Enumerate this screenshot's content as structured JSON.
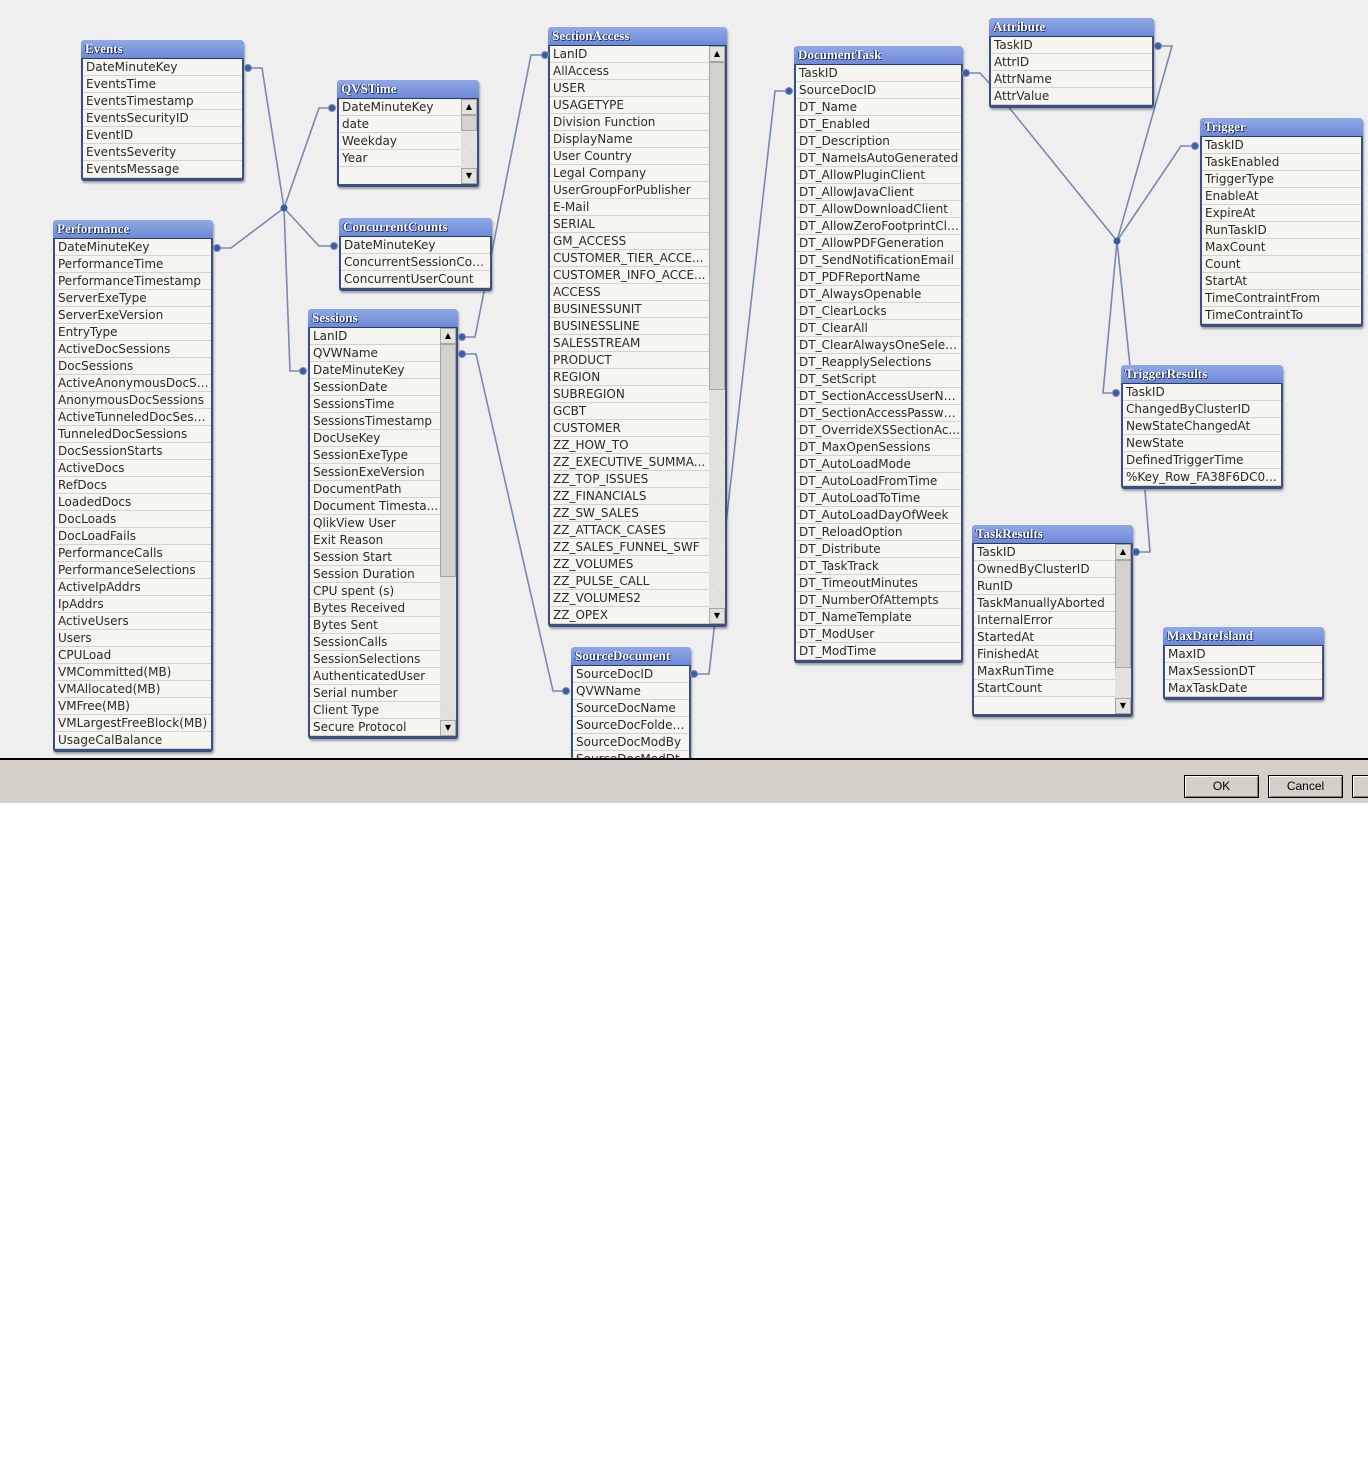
{
  "tables": {
    "events": {
      "title": "Events",
      "fields": [
        "DateMinuteKey",
        "EventsTime",
        "EventsTimestamp",
        "EventsSecurityID",
        "EventID",
        "EventsSeverity",
        "EventsMessage"
      ]
    },
    "qvstime": {
      "title": "QVSTime",
      "fields": [
        "DateMinuteKey",
        "date",
        "Weekday",
        "Year"
      ]
    },
    "concurrentcounts": {
      "title": "ConcurrentCounts",
      "fields": [
        "DateMinuteKey",
        "ConcurrentSessionCount",
        "ConcurrentUserCount"
      ]
    },
    "performance": {
      "title": "Performance",
      "fields": [
        "DateMinuteKey",
        "PerformanceTime",
        "PerformanceTimestamp",
        "ServerExeType",
        "ServerExeVersion",
        "EntryType",
        "ActiveDocSessions",
        "DocSessions",
        "ActiveAnonymousDocSe...",
        "AnonymousDocSessions",
        "ActiveTunneledDocSessi...",
        "TunneledDocSessions",
        "DocSessionStarts",
        "ActiveDocs",
        "RefDocs",
        "LoadedDocs",
        "DocLoads",
        "DocLoadFails",
        "PerformanceCalls",
        "PerformanceSelections",
        "ActiveIpAddrs",
        "IpAddrs",
        "ActiveUsers",
        "Users",
        "CPULoad",
        "VMCommitted(MB)",
        "VMAllocated(MB)",
        "VMFree(MB)",
        "VMLargestFreeBlock(MB)",
        "UsageCalBalance"
      ]
    },
    "sessions": {
      "title": "Sessions",
      "fields": [
        "LanID",
        "QVWName",
        "DateMinuteKey",
        "SessionDate",
        "SessionsTime",
        "SessionsTimestamp",
        "DocUseKey",
        "SessionExeType",
        "SessionExeVersion",
        "DocumentPath",
        "Document Timesta...",
        "QlikView User",
        "Exit Reason",
        "Session Start",
        "Session Duration",
        "CPU spent (s)",
        "Bytes Received",
        "Bytes Sent",
        "SessionCalls",
        "SessionSelections",
        "AuthenticatedUser",
        "Serial number",
        "Client Type",
        "Secure Protocol"
      ]
    },
    "sectionaccess": {
      "title": "SectionAccess",
      "fields": [
        "LanID",
        "AllAccess",
        "USER",
        "USAGETYPE",
        "Division Function",
        "DisplayName",
        "User Country",
        "Legal Company",
        "UserGroupForPublisher",
        "E-Mail",
        "SERIAL",
        "GM_ACCESS",
        "CUSTOMER_TIER_ACCE...",
        "CUSTOMER_INFO_ACCE...",
        "ACCESS",
        "BUSINESSUNIT",
        "BUSINESSLINE",
        "SALESSTREAM",
        "PRODUCT",
        "REGION",
        "SUBREGION",
        "GCBT",
        "CUSTOMER",
        "ZZ_HOW_TO",
        "ZZ_EXECUTIVE_SUMMA...",
        "ZZ_TOP_ISSUES",
        "ZZ_FINANCIALS",
        "ZZ_SW_SALES",
        "ZZ_ATTACK_CASES",
        "ZZ_SALES_FUNNEL_SWF",
        "ZZ_VOLUMES",
        "ZZ_PULSE_CALL",
        "ZZ_VOLUMES2",
        "ZZ_OPEX"
      ]
    },
    "sourcedocument": {
      "title": "SourceDocument",
      "fields": [
        "SourceDocID",
        "QVWName",
        "SourceDocName",
        "SourceDocFolderID",
        "SourceDocModBy",
        "SourceDocModDt"
      ]
    },
    "documenttask": {
      "title": "DocumentTask",
      "fields": [
        "TaskID",
        "SourceDocID",
        "DT_Name",
        "DT_Enabled",
        "DT_Description",
        "DT_NameIsAutoGenerated",
        "DT_AllowPluginClient",
        "DT_AllowJavaClient",
        "DT_AllowDownloadClient",
        "DT_AllowZeroFootprintCli...",
        "DT_AllowPDFGeneration",
        "DT_SendNotificationEmail",
        "DT_PDFReportName",
        "DT_AlwaysOpenable",
        "DT_ClearLocks",
        "DT_ClearAll",
        "DT_ClearAlwaysOneSelec...",
        "DT_ReapplySelections",
        "DT_SetScript",
        "DT_SectionAccessUserNa...",
        "DT_SectionAccessPassword",
        "DT_OverrideXSSectionAc...",
        "DT_MaxOpenSessions",
        "DT_AutoLoadMode",
        "DT_AutoLoadFromTime",
        "DT_AutoLoadToTime",
        "DT_AutoLoadDayOfWeek",
        "DT_ReloadOption",
        "DT_Distribute",
        "DT_TaskTrack",
        "DT_TimeoutMinutes",
        "DT_NumberOfAttempts",
        "DT_NameTemplate",
        "DT_ModUser",
        "DT_ModTime"
      ]
    },
    "attribute": {
      "title": "Attribute",
      "fields": [
        "TaskID",
        "AttrID",
        "AttrName",
        "AttrValue"
      ]
    },
    "trigger": {
      "title": "Trigger",
      "fields": [
        "TaskID",
        "TaskEnabled",
        "TriggerType",
        "EnableAt",
        "ExpireAt",
        "RunTaskID",
        "MaxCount",
        "Count",
        "StartAt",
        "TimeContraintFrom",
        "TimeContraintTo"
      ]
    },
    "triggerresults": {
      "title": "TriggerResults",
      "fields": [
        "TaskID",
        "ChangedByClusterID",
        "NewStateChangedAt",
        "NewState",
        "DefinedTriggerTime",
        "%Key_Row_FA38F6DC0..."
      ]
    },
    "taskresults": {
      "title": "TaskResults",
      "fields": [
        "TaskID",
        "OwnedByClusterID",
        "RunID",
        "TaskManuallyAborted",
        "InternalError",
        "StartedAt",
        "FinishedAt",
        "MaxRunTime",
        "StartCount"
      ]
    },
    "maxdateisland": {
      "title": "MaxDateIsland",
      "fields": [
        "MaxID",
        "MaxSessionDT",
        "MaxTaskDate"
      ]
    }
  },
  "footer": {
    "ok_label": "OK",
    "cancel_label": "Cancel"
  },
  "colors": {
    "link_line": "#7a88b0",
    "header_blue": "#7b97de",
    "canvas_bg": "#efefef"
  }
}
